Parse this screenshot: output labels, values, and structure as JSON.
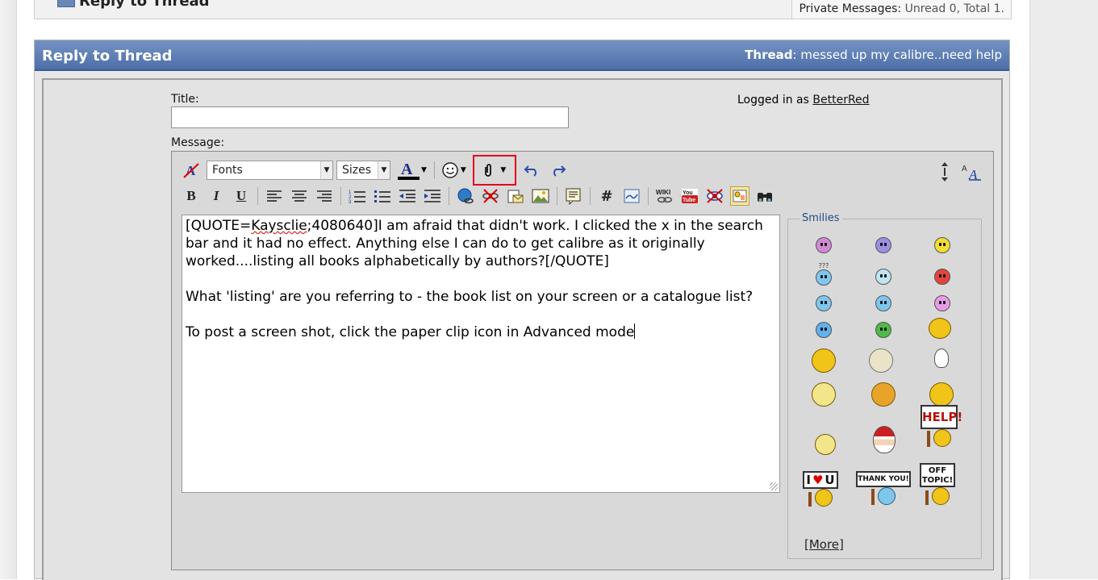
{
  "top_bar": {
    "title": "Reply to Thread",
    "pm_label": "Private Messages:",
    "pm_value": "Unread 0, Total 1."
  },
  "reply_header": {
    "title": "Reply to Thread",
    "thread_label": "Thread",
    "thread_sep": ":",
    "thread_value": "messed up my calibre..need help"
  },
  "form": {
    "title_label": "Title:",
    "title_value": "",
    "message_label": "Message:",
    "logged_in_prefix": "Logged in as",
    "username": "BetterRed"
  },
  "toolbar": {
    "font_select": "Fonts",
    "size_select": "Sizes",
    "bold": "B",
    "italic": "I",
    "underline": "U",
    "hash": "#",
    "wiki": "WIKI",
    "youtube": "You Tube"
  },
  "message": {
    "quote_open": "[QUOTE=",
    "quote_user": "Kaysclie",
    "quote_rest": ";4080640]I am afraid that didn't work. I clicked the x in the search bar and it had no effect. Anything else I can do to get calibre as it originally worked....listing all books alphabetically by authors?[/QUOTE]\n\nWhat 'listing' are you referring to - the book list on your screen or a catalogue list?\n\nTo post a screen shot, click the paper clip icon in Advanced mode"
  },
  "smilies": {
    "legend": "Smilies",
    "more": "[More]",
    "signs": {
      "help": "HELP!",
      "iloveu_i": "I",
      "iloveu_u": "U",
      "thank_you": "THANK YOU!",
      "off_topic": "OFF TOPIC!",
      "question": "???"
    }
  },
  "colors": {
    "header_blue": "#5b7bb3",
    "attach_highlight": "#e2001a",
    "smiley_yellow": "#f0c419"
  }
}
